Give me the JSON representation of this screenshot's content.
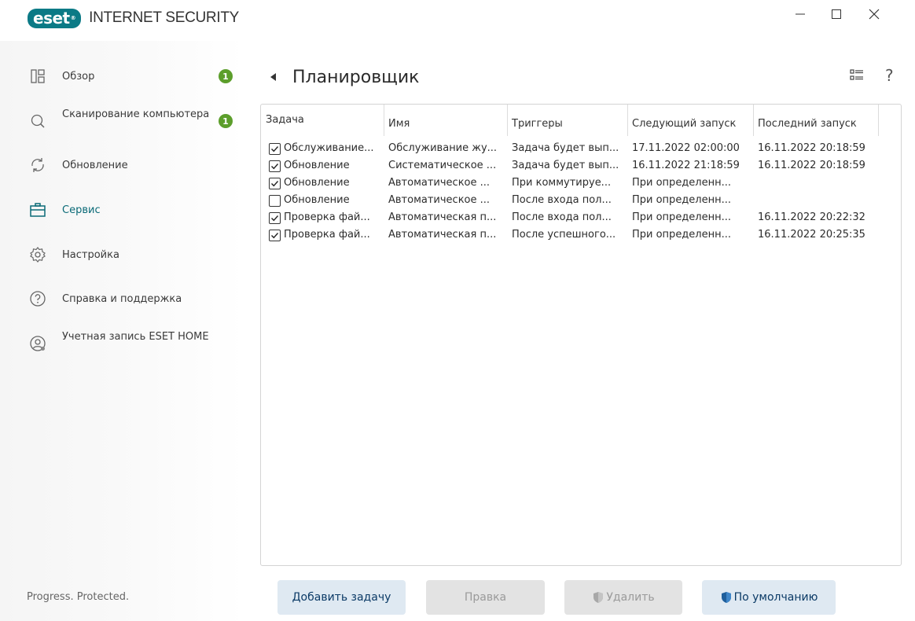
{
  "app": {
    "logo_text": "eset",
    "product_name": "INTERNET SECURITY",
    "tagline": "Progress. Protected."
  },
  "window_controls": {
    "minimize": "—",
    "maximize": "☐",
    "close": "✕"
  },
  "sidebar": {
    "items": [
      {
        "label": "Обзор",
        "icon": "overview-icon",
        "badge": "1",
        "active": false
      },
      {
        "label": "Сканирование компьютера",
        "icon": "scan-icon",
        "badge": "1",
        "active": false
      },
      {
        "label": "Обновление",
        "icon": "update-icon",
        "badge": null,
        "active": false
      },
      {
        "label": "Сервис",
        "icon": "briefcase-icon",
        "badge": null,
        "active": true
      },
      {
        "label": "Настройка",
        "icon": "gear-icon",
        "badge": null,
        "active": false
      },
      {
        "label": "Справка и поддержка",
        "icon": "help-icon",
        "badge": null,
        "active": false
      },
      {
        "label": "Учетная запись ESET HOME",
        "icon": "account-icon",
        "badge": null,
        "active": false
      }
    ]
  },
  "page": {
    "title": "Планировщик",
    "help": "?"
  },
  "table": {
    "columns": [
      "Задача",
      "Имя",
      "Триггеры",
      "Следующий запуск",
      "Последний запуск"
    ],
    "rows": [
      {
        "checked": true,
        "task": "Обслуживание...",
        "name": "Обслуживание жу...",
        "trigger": "Задача будет вып...",
        "next": "17.11.2022 02:00:00",
        "last": "16.11.2022 20:18:59"
      },
      {
        "checked": true,
        "task": "Обновление",
        "name": "Систематическое ...",
        "trigger": "Задача будет вып...",
        "next": "16.11.2022 21:18:59",
        "last": "16.11.2022 20:18:59"
      },
      {
        "checked": true,
        "task": "Обновление",
        "name": "Автоматическое ...",
        "trigger": "При коммутируе...",
        "next": "При определенн...",
        "last": ""
      },
      {
        "checked": false,
        "task": "Обновление",
        "name": "Автоматическое ...",
        "trigger": "После входа пол...",
        "next": "При определенн...",
        "last": ""
      },
      {
        "checked": true,
        "task": "Проверка фай...",
        "name": "Автоматическая п...",
        "trigger": "После входа пол...",
        "next": "При определенн...",
        "last": "16.11.2022 20:22:32"
      },
      {
        "checked": true,
        "task": "Проверка фай...",
        "name": "Автоматическая п...",
        "trigger": "После успешного...",
        "next": "При определенн...",
        "last": "16.11.2022 20:25:35"
      }
    ]
  },
  "buttons": {
    "add": "Добавить задачу",
    "edit": "Правка",
    "delete": "Удалить",
    "default": "По умолчанию"
  },
  "colors": {
    "brand": "#0b7a86",
    "badge": "#5c9e2b",
    "active_nav": "#0a6a77",
    "primary_button_bg": "#dfe9f2",
    "primary_button_text": "#0b3a66"
  }
}
